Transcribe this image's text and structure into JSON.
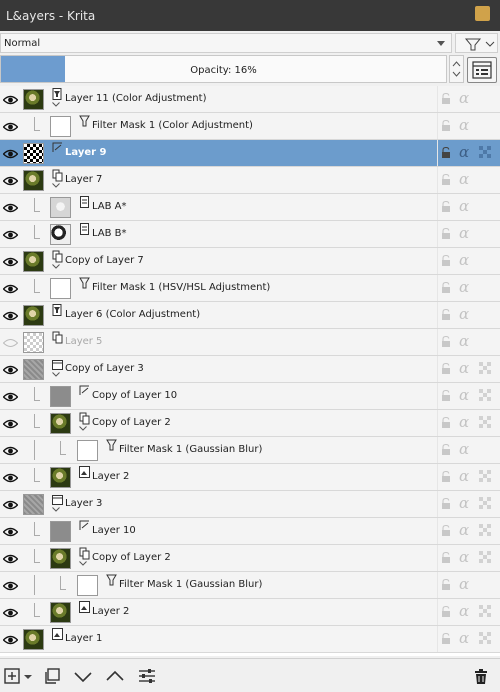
{
  "window": {
    "title": "L&ayers - Krita"
  },
  "toolbar": {
    "blend_mode": "Normal",
    "opacity_label": "Opacity:  16%",
    "opacity_fraction": 0.144
  },
  "layers": [
    {
      "name": "Layer 11 (Color Adjustment)",
      "bold": false,
      "dim": false,
      "selected": false,
      "indent": 0,
      "thumb": "photo",
      "type": "filter-layer",
      "visible": true,
      "expandable": true
    },
    {
      "name": "Filter Mask 1 (Color Adjustment)",
      "bold": false,
      "dim": false,
      "selected": false,
      "indent": 1,
      "thumb": "white",
      "type": "filter-mask",
      "visible": true,
      "expandable": false
    },
    {
      "name": "Layer 9",
      "bold": true,
      "dim": false,
      "selected": true,
      "indent": 0,
      "thumb": "checker",
      "type": "paint",
      "visible": true,
      "expandable": false
    },
    {
      "name": "Layer 7",
      "bold": false,
      "dim": false,
      "selected": false,
      "indent": 0,
      "thumb": "photo",
      "type": "clone",
      "visible": true,
      "expandable": true
    },
    {
      "name": "LAB A*",
      "bold": false,
      "dim": false,
      "selected": false,
      "indent": 1,
      "thumb": "grey-light",
      "type": "mask",
      "visible": true,
      "expandable": false
    },
    {
      "name": "LAB B*",
      "bold": false,
      "dim": false,
      "selected": false,
      "indent": 1,
      "thumb": "bw",
      "type": "mask",
      "visible": true,
      "expandable": false
    },
    {
      "name": "Copy of Layer 7",
      "bold": false,
      "dim": false,
      "selected": false,
      "indent": 0,
      "thumb": "photo",
      "type": "clone",
      "visible": true,
      "expandable": true
    },
    {
      "name": "Filter Mask 1 (HSV/HSL Adjustment)",
      "bold": false,
      "dim": false,
      "selected": false,
      "indent": 1,
      "thumb": "white",
      "type": "filter-mask",
      "visible": true,
      "expandable": false
    },
    {
      "name": "Layer 6 (Color Adjustment)",
      "bold": false,
      "dim": false,
      "selected": false,
      "indent": 0,
      "thumb": "photo",
      "type": "filter-layer",
      "visible": true,
      "expandable": false
    },
    {
      "name": "Layer 5",
      "bold": false,
      "dim": true,
      "selected": false,
      "indent": 0,
      "thumb": "checker-light",
      "type": "clone",
      "visible": false,
      "expandable": false
    },
    {
      "name": "Copy of Layer 3",
      "bold": false,
      "dim": false,
      "selected": false,
      "indent": 0,
      "thumb": "grey-noise",
      "type": "group",
      "visible": true,
      "expandable": true
    },
    {
      "name": "Copy of Layer 10",
      "bold": false,
      "dim": false,
      "selected": false,
      "indent": 1,
      "thumb": "grey",
      "type": "paint",
      "visible": true,
      "expandable": false
    },
    {
      "name": "Copy of Layer 2",
      "bold": false,
      "dim": false,
      "selected": false,
      "indent": 1,
      "thumb": "photo",
      "type": "clone",
      "visible": true,
      "expandable": true
    },
    {
      "name": "Filter Mask 1 (Gaussian Blur)",
      "bold": false,
      "dim": false,
      "selected": false,
      "indent": 2,
      "thumb": "white",
      "type": "filter-mask",
      "visible": true,
      "expandable": false
    },
    {
      "name": "Layer 2",
      "bold": false,
      "dim": false,
      "selected": false,
      "indent": 1,
      "thumb": "photo",
      "type": "paint-img",
      "visible": true,
      "expandable": false
    },
    {
      "name": "Layer 3",
      "bold": false,
      "dim": false,
      "selected": false,
      "indent": 0,
      "thumb": "grey-noise",
      "type": "group",
      "visible": true,
      "expandable": true
    },
    {
      "name": "Layer 10",
      "bold": false,
      "dim": false,
      "selected": false,
      "indent": 1,
      "thumb": "grey",
      "type": "paint",
      "visible": true,
      "expandable": false
    },
    {
      "name": "Copy of Layer 2",
      "bold": false,
      "dim": false,
      "selected": false,
      "indent": 1,
      "thumb": "photo",
      "type": "clone",
      "visible": true,
      "expandable": true
    },
    {
      "name": "Filter Mask 1 (Gaussian Blur)",
      "bold": false,
      "dim": false,
      "selected": false,
      "indent": 2,
      "thumb": "white",
      "type": "filter-mask",
      "visible": true,
      "expandable": false
    },
    {
      "name": "Layer 2",
      "bold": false,
      "dim": false,
      "selected": false,
      "indent": 1,
      "thumb": "photo",
      "type": "paint-img",
      "visible": true,
      "expandable": false
    },
    {
      "name": "Layer 1",
      "bold": false,
      "dim": false,
      "selected": false,
      "indent": 0,
      "thumb": "photo",
      "type": "paint-img",
      "visible": true,
      "expandable": false
    }
  ],
  "row_properties": [
    {
      "alpha_locked": false,
      "inherit_alpha": false
    },
    {
      "alpha_locked": false,
      "inherit_alpha": false
    },
    {
      "alpha_locked": true,
      "inherit_alpha": true
    },
    {
      "alpha_locked": false,
      "inherit_alpha": false
    },
    {
      "alpha_locked": false,
      "inherit_alpha": false
    },
    {
      "alpha_locked": false,
      "inherit_alpha": false
    },
    {
      "alpha_locked": false,
      "inherit_alpha": false
    },
    {
      "alpha_locked": false,
      "inherit_alpha": false
    },
    {
      "alpha_locked": false,
      "inherit_alpha": false
    },
    {
      "alpha_locked": false,
      "inherit_alpha": false
    },
    {
      "alpha_locked": false,
      "inherit_alpha": true
    },
    {
      "alpha_locked": false,
      "inherit_alpha": true
    },
    {
      "alpha_locked": false,
      "inherit_alpha": true
    },
    {
      "alpha_locked": false,
      "inherit_alpha": false
    },
    {
      "alpha_locked": false,
      "inherit_alpha": true
    },
    {
      "alpha_locked": false,
      "inherit_alpha": true
    },
    {
      "alpha_locked": false,
      "inherit_alpha": true
    },
    {
      "alpha_locked": false,
      "inherit_alpha": true
    },
    {
      "alpha_locked": false,
      "inherit_alpha": false
    },
    {
      "alpha_locked": false,
      "inherit_alpha": true
    },
    {
      "alpha_locked": false,
      "inherit_alpha": true
    }
  ],
  "bottom_toolbar": [
    "add-layer-icon",
    "dropdown-arrow-icon",
    "duplicate-layer-icon",
    "move-down-icon",
    "move-up-icon",
    "layer-properties-icon",
    "delete-layer-icon"
  ],
  "colors": {
    "selection": "#6c9ccc",
    "opacity_fill": "#6d9ccf",
    "titlebar": "#383838",
    "close_button": "#d0a24a"
  }
}
